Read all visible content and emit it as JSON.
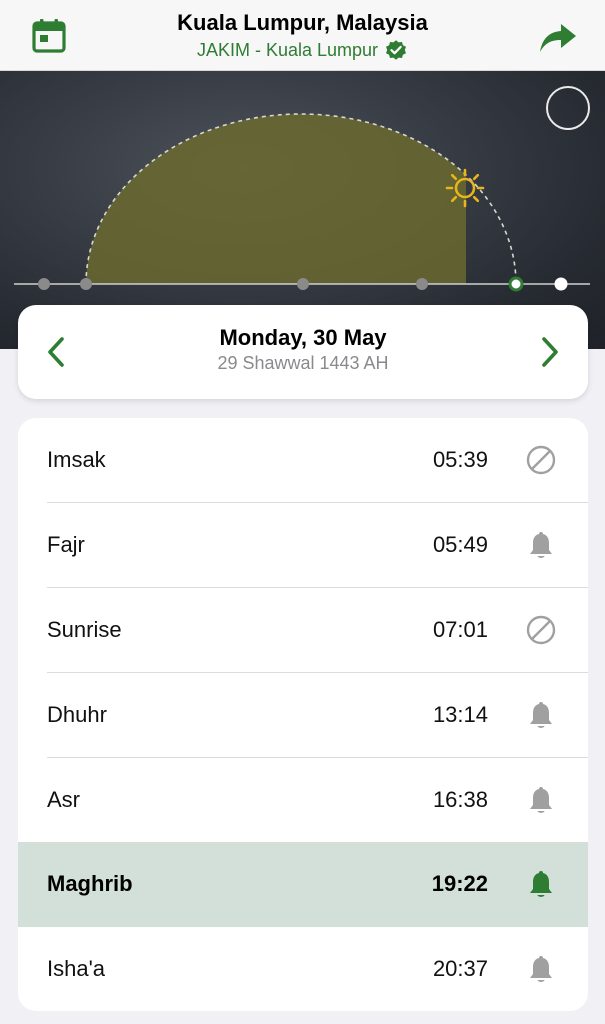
{
  "header": {
    "title": "Kuala Lumpur, Malaysia",
    "subtitle": "JAKIM - Kuala Lumpur",
    "calendar_icon": "calendar-icon",
    "share_icon": "share-arrow-icon",
    "verified_icon": "verified-badge-icon",
    "accent": "#2e7d32"
  },
  "date": {
    "gregorian": "Monday, 30 May",
    "hijri": "29 Shawwal 1443 AH"
  },
  "prayers": [
    {
      "name": "Imsak",
      "time": "05:39",
      "icon": "alarm-off-icon",
      "active": false
    },
    {
      "name": "Fajr",
      "time": "05:49",
      "icon": "bell-icon",
      "active": false
    },
    {
      "name": "Sunrise",
      "time": "07:01",
      "icon": "alarm-off-icon",
      "active": false
    },
    {
      "name": "Dhuhr",
      "time": "13:14",
      "icon": "bell-icon",
      "active": false
    },
    {
      "name": "Asr",
      "time": "16:38",
      "icon": "bell-icon",
      "active": false
    },
    {
      "name": "Maghrib",
      "time": "19:22",
      "icon": "bell-icon",
      "active": true
    },
    {
      "name": "Isha'a",
      "time": "20:37",
      "icon": "bell-icon",
      "active": false
    }
  ]
}
